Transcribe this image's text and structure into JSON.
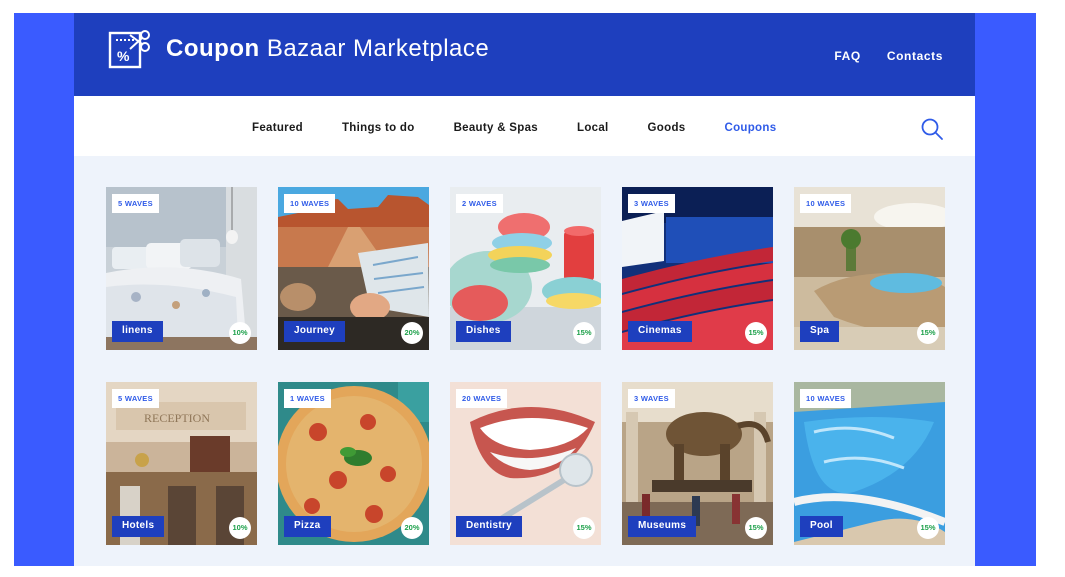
{
  "header": {
    "brand_bold": "Coupon",
    "brand_light": "Bazaar Marketplace",
    "links": [
      "FAQ",
      "Contacts"
    ]
  },
  "nav": {
    "items": [
      "Featured",
      "Things to do",
      "Beauty & Spas",
      "Local",
      "Goods",
      "Coupons"
    ],
    "active": "Coupons"
  },
  "icons": {
    "logo": "coupon-scissors-icon",
    "search": "search-icon"
  },
  "colors": {
    "header": "#1e3fbe",
    "accent": "#2f5be8",
    "background": "#3a5bff",
    "discount": "#1da04a"
  },
  "cards": [
    {
      "waves": "5 WAVES",
      "label": "linens",
      "discount": "10%"
    },
    {
      "waves": "10 WAVES",
      "label": "Journey",
      "discount": "20%"
    },
    {
      "waves": "2 WAVES",
      "label": "Dishes",
      "discount": "15%"
    },
    {
      "waves": "3 WAVES",
      "label": "Cinemas",
      "discount": "15%"
    },
    {
      "waves": "10 WAVES",
      "label": "Spa",
      "discount": "15%"
    },
    {
      "waves": "5 WAVES",
      "label": "Hotels",
      "discount": "10%"
    },
    {
      "waves": "1 WAVES",
      "label": "Pizza",
      "discount": "20%"
    },
    {
      "waves": "20 WAVES",
      "label": "Dentistry",
      "discount": "15%"
    },
    {
      "waves": "3 WAVES",
      "label": "Museums",
      "discount": "15%"
    },
    {
      "waves": "10 WAVES",
      "label": "Pool",
      "discount": "15%"
    }
  ]
}
